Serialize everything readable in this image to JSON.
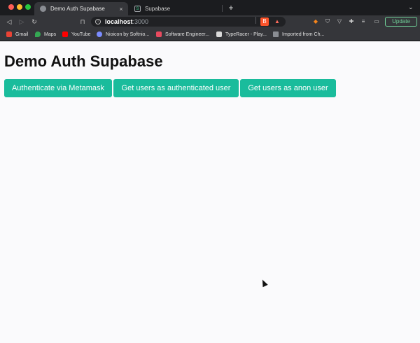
{
  "browser": {
    "tabs": [
      {
        "title": "Demo Auth Supabase",
        "active": true,
        "close_label": "×"
      },
      {
        "title": "Supabase",
        "active": false,
        "favicon_text": "S"
      }
    ],
    "new_tab_label": "+",
    "tab_menu_label": "⌄",
    "nav": {
      "back": "◁",
      "forward": "▷",
      "reload": "↻",
      "bookmark": "⊓"
    },
    "address": {
      "host": "localhost",
      "port": ":3000",
      "info_glyph": "i"
    },
    "update_label": "Update",
    "bookmarks": [
      {
        "label": "Gmail"
      },
      {
        "label": "Maps"
      },
      {
        "label": "YouTube"
      },
      {
        "label": "Nioicon by Softnio..."
      },
      {
        "label": "Software Engineer..."
      },
      {
        "label": "TypeRacer - Play..."
      },
      {
        "label": "Imported from Ch..."
      }
    ],
    "colors": {
      "accent_button": "#1abc9c",
      "update_border": "#6fcf97"
    }
  },
  "page": {
    "title": "Demo Auth Supabase",
    "buttons": {
      "metamask": "Authenticate via Metamask",
      "auth_users": "Get users as authenticated user",
      "anon_users": "Get users as anon user"
    }
  }
}
